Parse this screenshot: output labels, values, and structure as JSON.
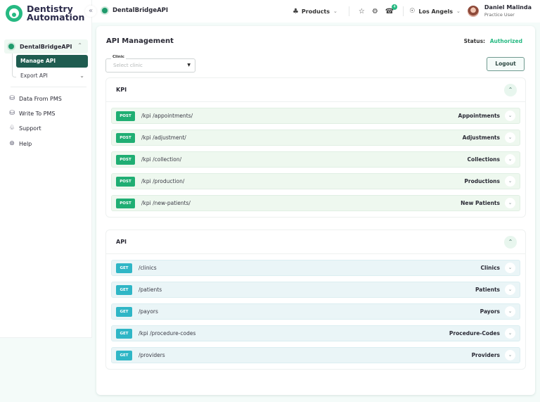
{
  "app": {
    "logo_line1": "Dentistry",
    "logo_line2": "Automation",
    "collapse_icon": "«"
  },
  "sidebar": {
    "parent": {
      "label": "DentalBridgeAPI",
      "icon": "dot-icon",
      "chevron": "^"
    },
    "children": [
      {
        "label": "Manage API",
        "active": true
      },
      {
        "label": "Export API",
        "chevron": "⌄"
      }
    ],
    "items": [
      {
        "label": "Data From PMS",
        "icon": "database-icon",
        "glyph": "⛁"
      },
      {
        "label": "Write To PMS",
        "icon": "database-icon",
        "glyph": "⛁"
      },
      {
        "label": "Support",
        "icon": "support-icon",
        "glyph": "♧"
      },
      {
        "label": "Help",
        "icon": "help-icon",
        "glyph": "⊛"
      }
    ]
  },
  "topbar": {
    "breadcrumb": "DentalBridgeAPI",
    "products_label": "Products",
    "notification_count": "4",
    "location": "Los Angels",
    "user_name": "Daniel Malinda",
    "user_role": "Practice User"
  },
  "main": {
    "title": "API Management",
    "status_label": "Status:",
    "status_value": "Authorized",
    "clinic_legend": "Clinic",
    "clinic_placeholder": "Select clinic",
    "logout_label": "Logout",
    "colors": {
      "accent": "#26b982",
      "post": "#1fae73",
      "get": "#2fb6c6",
      "active_nav": "#1f5c50"
    }
  },
  "sections": {
    "kpi": {
      "title": "KPI",
      "rows": [
        {
          "method": "POST",
          "path": "/kpi /appointments/",
          "summary": "Appointments"
        },
        {
          "method": "POST",
          "path": "/kpi /adjustment/",
          "summary": "Adjustments"
        },
        {
          "method": "POST",
          "path": "/kpi /collection/",
          "summary": "Collections"
        },
        {
          "method": "POST",
          "path": "/kpi /production/",
          "summary": "Productions"
        },
        {
          "method": "POST",
          "path": "/kpi /new-patients/",
          "summary": "New Patients"
        }
      ]
    },
    "api": {
      "title": "API",
      "rows": [
        {
          "method": "GET",
          "path": "/clinics",
          "summary": "Clinics"
        },
        {
          "method": "GET",
          "path": "/patients",
          "summary": "Patients"
        },
        {
          "method": "GET",
          "path": "/payors",
          "summary": "Payors"
        },
        {
          "method": "GET",
          "path": "/kpi /procedure-codes",
          "summary": "Procedure-Codes"
        },
        {
          "method": "GET",
          "path": "/providers",
          "summary": "Providers"
        }
      ]
    }
  }
}
